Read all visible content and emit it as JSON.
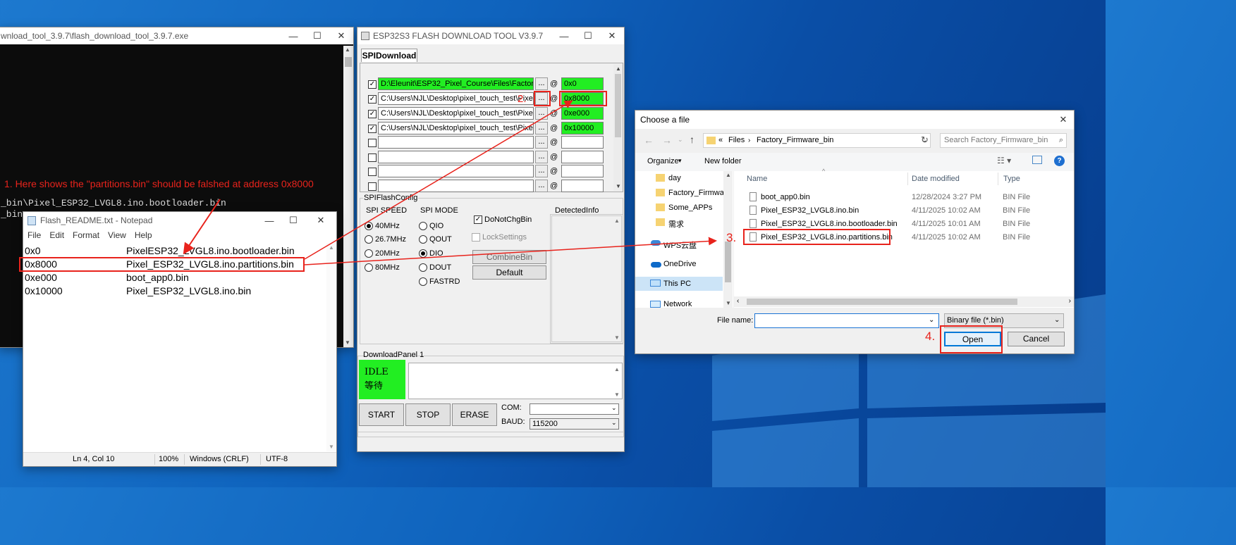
{
  "console": {
    "title": "wnload_tool_3.9.7\\flash_download_tool_3.9.7.exe",
    "lines": [
      "_bin\\Pixel_ESP32_LVGL8.ino.bootloader.bin",
      "_bin"
    ]
  },
  "notepad": {
    "title": "Flash_README.txt - Notepad",
    "menu": [
      "File",
      "Edit",
      "Format",
      "View",
      "Help"
    ],
    "rows": [
      {
        "addr": "0x0",
        "file": "PixelESP32_LVGL8.ino.bootloader.bin"
      },
      {
        "addr": "0x8000",
        "file": "Pixel_ESP32_LVGL8.ino.partitions.bin"
      },
      {
        "addr": "0xe000",
        "file": "boot_app0.bin"
      },
      {
        "addr": "0x10000",
        "file": "Pixel_ESP32_LVGL8.ino.bin"
      }
    ],
    "status": {
      "pos": "Ln 4, Col 10",
      "zoom": "100%",
      "eol": "Windows (CRLF)",
      "enc": "UTF-8"
    }
  },
  "flash_tool": {
    "title": "ESP32S3 FLASH DOWNLOAD TOOL V3.9.7",
    "tab": "SPIDownload",
    "entries": [
      {
        "path": "D:\\Eleunit\\ESP32_Pixel_Course\\Files\\Factory_",
        "addr": "0x0",
        "checked": true
      },
      {
        "path": "C:\\Users\\NJL\\Desktop\\pixel_touch_test\\Pixel_",
        "addr": "0x8000",
        "checked": true
      },
      {
        "path": "C:\\Users\\NJL\\Desktop\\pixel_touch_test\\Pixel_",
        "addr": "0xe000",
        "checked": true
      },
      {
        "path": "C:\\Users\\NJL\\Desktop\\pixel_touch_test\\Pixel_",
        "addr": "0x10000",
        "checked": true
      },
      {
        "path": "",
        "addr": "",
        "checked": false
      },
      {
        "path": "",
        "addr": "",
        "checked": false
      },
      {
        "path": "",
        "addr": "",
        "checked": false
      },
      {
        "path": "",
        "addr": "",
        "checked": false
      }
    ],
    "dots": "...",
    "at": "@",
    "config_label": "SPIFlashConfig",
    "spi_speed_label": "SPI SPEED",
    "speeds": [
      "40MHz",
      "26.7MHz",
      "20MHz",
      "80MHz"
    ],
    "spi_mode_label": "SPI MODE",
    "modes": [
      "QIO",
      "QOUT",
      "DIO",
      "DOUT",
      "FASTRD"
    ],
    "dnc": "DoNotChgBin",
    "lock": "LockSettings",
    "combine": "CombineBin",
    "default": "Default",
    "detected": "DetectedInfo",
    "panel_label": "DownloadPanel 1",
    "idle": "IDLE",
    "idle_cn": "等待",
    "start": "START",
    "stop": "STOP",
    "erase": "ERASE",
    "com_label": "COM:",
    "baud_label": "BAUD:",
    "baud": "115200",
    "color_idle": "#22ee22"
  },
  "dialog": {
    "title": "Choose a file",
    "breadcrumb": [
      "Files",
      "Factory_Firmware_bin"
    ],
    "crumb_prefix": "«",
    "search_placeholder": "Search Factory_Firmware_bin",
    "organize": "Organize",
    "new_folder": "New folder",
    "nav": [
      "day",
      "Factory_Firmwar",
      "Some_APPs",
      "需求",
      "WPS云盘",
      "OneDrive",
      "This PC",
      "Network"
    ],
    "headers": {
      "name": "Name",
      "date": "Date modified",
      "type": "Type"
    },
    "files": [
      {
        "name": "boot_app0.bin",
        "date": "12/28/2024 3:27 PM",
        "type": "BIN File"
      },
      {
        "name": "Pixel_ESP32_LVGL8.ino.bin",
        "date": "4/11/2025 10:02 AM",
        "type": "BIN File"
      },
      {
        "name": "Pixel_ESP32_LVGL8.ino.bootloader.bin",
        "date": "4/11/2025 10:01 AM",
        "type": "BIN File"
      },
      {
        "name": "Pixel_ESP32_LVGL8.ino.partitions.bin",
        "date": "4/11/2025 10:02 AM",
        "type": "BIN File"
      }
    ],
    "file_name_label": "File name:",
    "file_name_value": "",
    "filter": "Binary file (*.bin)",
    "open": "Open",
    "cancel": "Cancel"
  },
  "annotations": {
    "a1": "1. Here shows the \"partitions.bin\" should be falshed at address 0x8000",
    "a2": "2.",
    "a3": "3.",
    "a4": "4.",
    "color": "#e8231c"
  }
}
